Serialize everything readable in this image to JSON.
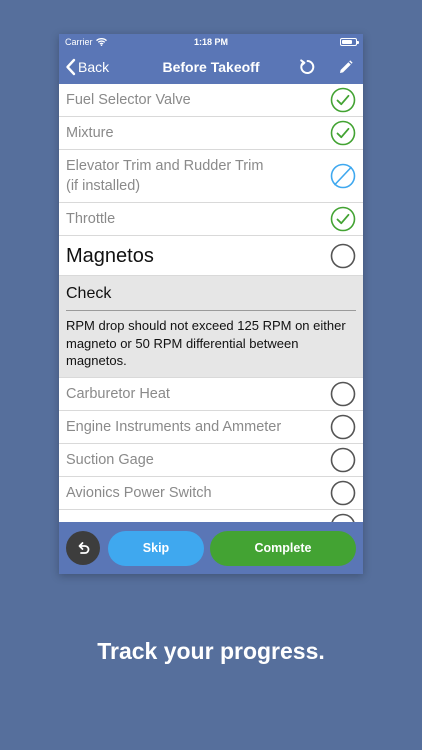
{
  "status_bar": {
    "carrier": "Carrier",
    "time": "1:18 PM"
  },
  "nav": {
    "back_label": "Back",
    "title": "Before Takeoff"
  },
  "items": [
    {
      "label": "Fuel Selector Valve",
      "state": "checked"
    },
    {
      "label": "Mixture",
      "state": "checked"
    },
    {
      "label": "Elevator Trim and Rudder Trim",
      "sublabel": "(if installed)",
      "state": "skipped"
    },
    {
      "label": "Throttle",
      "state": "checked"
    }
  ],
  "current": {
    "label": "Magnetos",
    "state": "unchecked",
    "action": "Check",
    "note": "RPM drop should not exceed 125 RPM on either magneto or 50 RPM differential between magnetos."
  },
  "upcoming": [
    {
      "label": "Carburetor Heat",
      "state": "unchecked"
    },
    {
      "label": "Engine Instruments and Ammeter",
      "state": "unchecked"
    },
    {
      "label": "Suction Gage",
      "state": "unchecked"
    },
    {
      "label": "Avionics Power Switch",
      "state": "unchecked"
    }
  ],
  "buttons": {
    "skip": "Skip",
    "complete": "Complete"
  },
  "caption": "Track your progress.",
  "colors": {
    "background": "#566f9c",
    "bar": "#5a76b6",
    "checked": "#43a333",
    "skipped": "#3fa8ef",
    "unchecked": "#555555",
    "skip_button": "#3fa8ef",
    "complete_button": "#43a333"
  }
}
